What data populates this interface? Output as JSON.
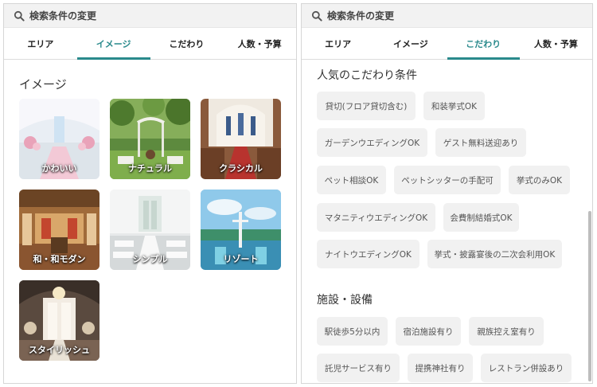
{
  "left": {
    "search_title": "検索条件の変更",
    "tabs": [
      "エリア",
      "イメージ",
      "こだわり",
      "人数・予算"
    ],
    "active_tab": 1,
    "section_title": "イメージ",
    "tiles": [
      "かわいい",
      "ナチュラル",
      "クラシカル",
      "和・和モダン",
      "シンプル",
      "リゾート",
      "スタイリッシュ"
    ]
  },
  "right": {
    "search_title": "検索条件の変更",
    "tabs": [
      "エリア",
      "イメージ",
      "こだわり",
      "人数・予算"
    ],
    "active_tab": 2,
    "sections": [
      {
        "title": "人気のこだわり条件",
        "chips": [
          "貸切(フロア貸切含む)",
          "和装挙式OK",
          "ガーデンウエディングOK",
          "ゲスト無料送迎あり",
          "ペット相談OK",
          "ペットシッターの手配可",
          "挙式のみOK",
          "マタニティウエディングOK",
          "会費制結婚式OK",
          "ナイトウエディングOK",
          "挙式・披露宴後の二次会利用OK"
        ]
      },
      {
        "title": "施設・設備",
        "chips": [
          "駅徒歩5分以内",
          "宿泊施設有り",
          "親族控え室有り",
          "託児サービス有り",
          "提携神社有り",
          "レストラン併設あり"
        ]
      }
    ]
  },
  "colors": {
    "accent": "#2a8a8c",
    "chip_bg": "#f1f1f1",
    "header_bg": "#f2f2f2"
  }
}
